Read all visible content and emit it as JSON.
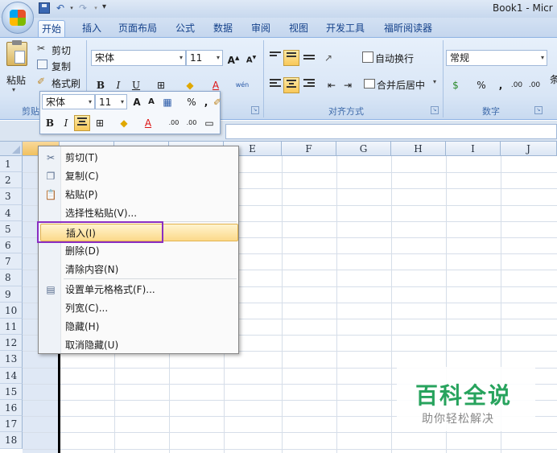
{
  "window": {
    "title": "Book1 - Micr"
  },
  "quick_access": {
    "undo_dropdown": "▾",
    "redo_dropdown": "▾",
    "more": "▾"
  },
  "tabs": [
    "开始",
    "插入",
    "页面布局",
    "公式",
    "数据",
    "审阅",
    "视图",
    "开发工具",
    "福昕阅读器"
  ],
  "ribbon": {
    "clipboard": {
      "paste_label": "粘贴",
      "cut_label": "剪切",
      "copy_label": "复制",
      "format_painter_label": "格式刷",
      "group_label": "剪贴"
    },
    "font": {
      "font_name": "宋体",
      "font_size": "11",
      "grow_label": "A",
      "shrink_label": "A",
      "bold": "B",
      "italic": "I",
      "underline": "U",
      "color_letter": "A",
      "phonetic_label": "wén"
    },
    "alignment": {
      "wrap_text_label": "自动换行",
      "merge_center_label": "合并后居中",
      "group_label": "对齐方式"
    },
    "number": {
      "format_value": "常规",
      "percent": "%",
      "comma": ",",
      "inc_decimal": ".00",
      "dec_decimal": ".00",
      "group_label": "数字"
    },
    "more_label": "条"
  },
  "mini_toolbar": {
    "font_name": "宋体",
    "font_size": "11",
    "grow_label": "A",
    "shrink_label": "A",
    "percent": "%",
    "comma": ",",
    "bold": "B",
    "italic": "I",
    "color_letter": "A",
    "inc_decimal": ".00",
    "dec_decimal": ".00"
  },
  "grid": {
    "columns": [
      "E",
      "F",
      "G",
      "H",
      "I",
      "J"
    ],
    "rows": [
      "1",
      "2",
      "3",
      "4",
      "5",
      "6",
      "7",
      "8",
      "9",
      "10",
      "11",
      "12",
      "13",
      "14",
      "15",
      "16",
      "17",
      "18"
    ]
  },
  "context_menu": {
    "items": [
      {
        "label": "剪切(T)",
        "icon": "scissors-icon"
      },
      {
        "label": "复制(C)",
        "icon": "copy-icon"
      },
      {
        "label": "粘贴(P)",
        "icon": "paste-icon"
      },
      {
        "label": "选择性粘贴(V)...",
        "icon": ""
      },
      {
        "label": "插入(I)",
        "icon": ""
      },
      {
        "label": "删除(D)",
        "icon": ""
      },
      {
        "label": "清除内容(N)",
        "icon": ""
      },
      {
        "label": "设置单元格格式(F)...",
        "icon": "format-cells-icon"
      },
      {
        "label": "列宽(C)...",
        "icon": ""
      },
      {
        "label": "隐藏(H)",
        "icon": ""
      },
      {
        "label": "取消隐藏(U)",
        "icon": ""
      }
    ],
    "highlighted_index": 4
  },
  "watermark": {
    "title": "百科全说",
    "subtitle": "助你轻松解决"
  },
  "colors": {
    "accent_purple": "#8a2ec2",
    "watermark_green": "#27a35d",
    "ribbon_blue": "#15428b"
  }
}
